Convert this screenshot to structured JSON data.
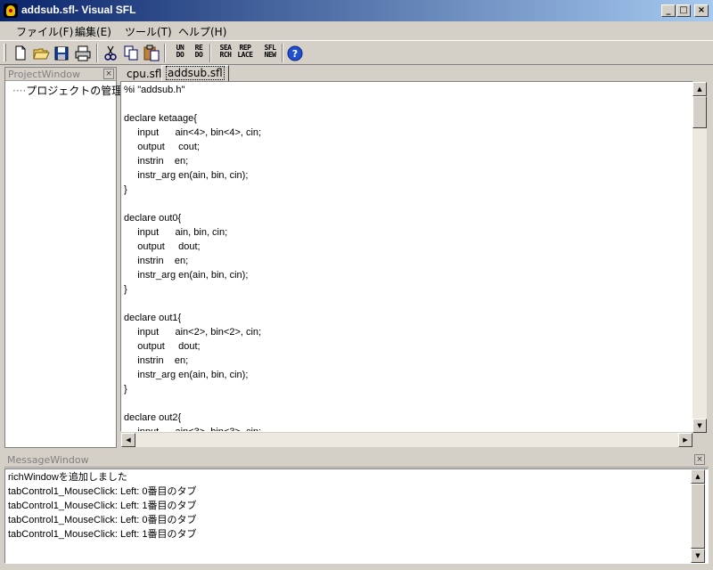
{
  "window": {
    "title": "addsub.sfl- Visual SFL"
  },
  "menu": [
    {
      "label": "ファイル(F)"
    },
    {
      "label": "編集(E)"
    },
    {
      "label": "ツール(T)"
    },
    {
      "label": "ヘルプ(H)"
    }
  ],
  "toolbar": {
    "text_buttons": [
      {
        "line1": "UN",
        "line2": "DO"
      },
      {
        "line1": "RE",
        "line2": "DO"
      },
      {
        "line1": "SEA",
        "line2": "RCH"
      },
      {
        "line1": "REP",
        "line2": "LACE"
      },
      {
        "line1": "SFL",
        "line2": "NEW"
      }
    ]
  },
  "project_window": {
    "title": "ProjectWindow",
    "items": [
      {
        "label": "プロジェクトの管理"
      }
    ]
  },
  "editor": {
    "tabs": [
      {
        "label": "cpu.sfl"
      },
      {
        "label": "addsub.sfl"
      }
    ],
    "active_tab": "addsub.sfl",
    "lines": [
      "%i \"addsub.h\"",
      "",
      "declare ketaage{",
      "     input      ain<4>, bin<4>, cin;",
      "     output     cout;",
      "     instrin    en;",
      "     instr_arg en(ain, bin, cin);",
      "}",
      "",
      "declare out0{",
      "     input      ain, bin, cin;",
      "     output     dout;",
      "     instrin    en;",
      "     instr_arg en(ain, bin, cin);",
      "}",
      "",
      "declare out1{",
      "     input      ain<2>, bin<2>, cin;",
      "     output     dout;",
      "     instrin    en;",
      "     instr_arg en(ain, bin, cin);",
      "}",
      "",
      "declare out2{",
      "     input      ain<3>, bin<3>, cin;"
    ]
  },
  "message_window": {
    "title": "MessageWindow",
    "lines": [
      "richWindowを追加しました",
      "tabControl1_MouseClick: Left: 0番目のタブ",
      "tabControl1_MouseClick: Left: 1番目のタブ",
      "tabControl1_MouseClick: Left: 0番目のタブ",
      "tabControl1_MouseClick: Left: 1番目のタブ"
    ]
  }
}
